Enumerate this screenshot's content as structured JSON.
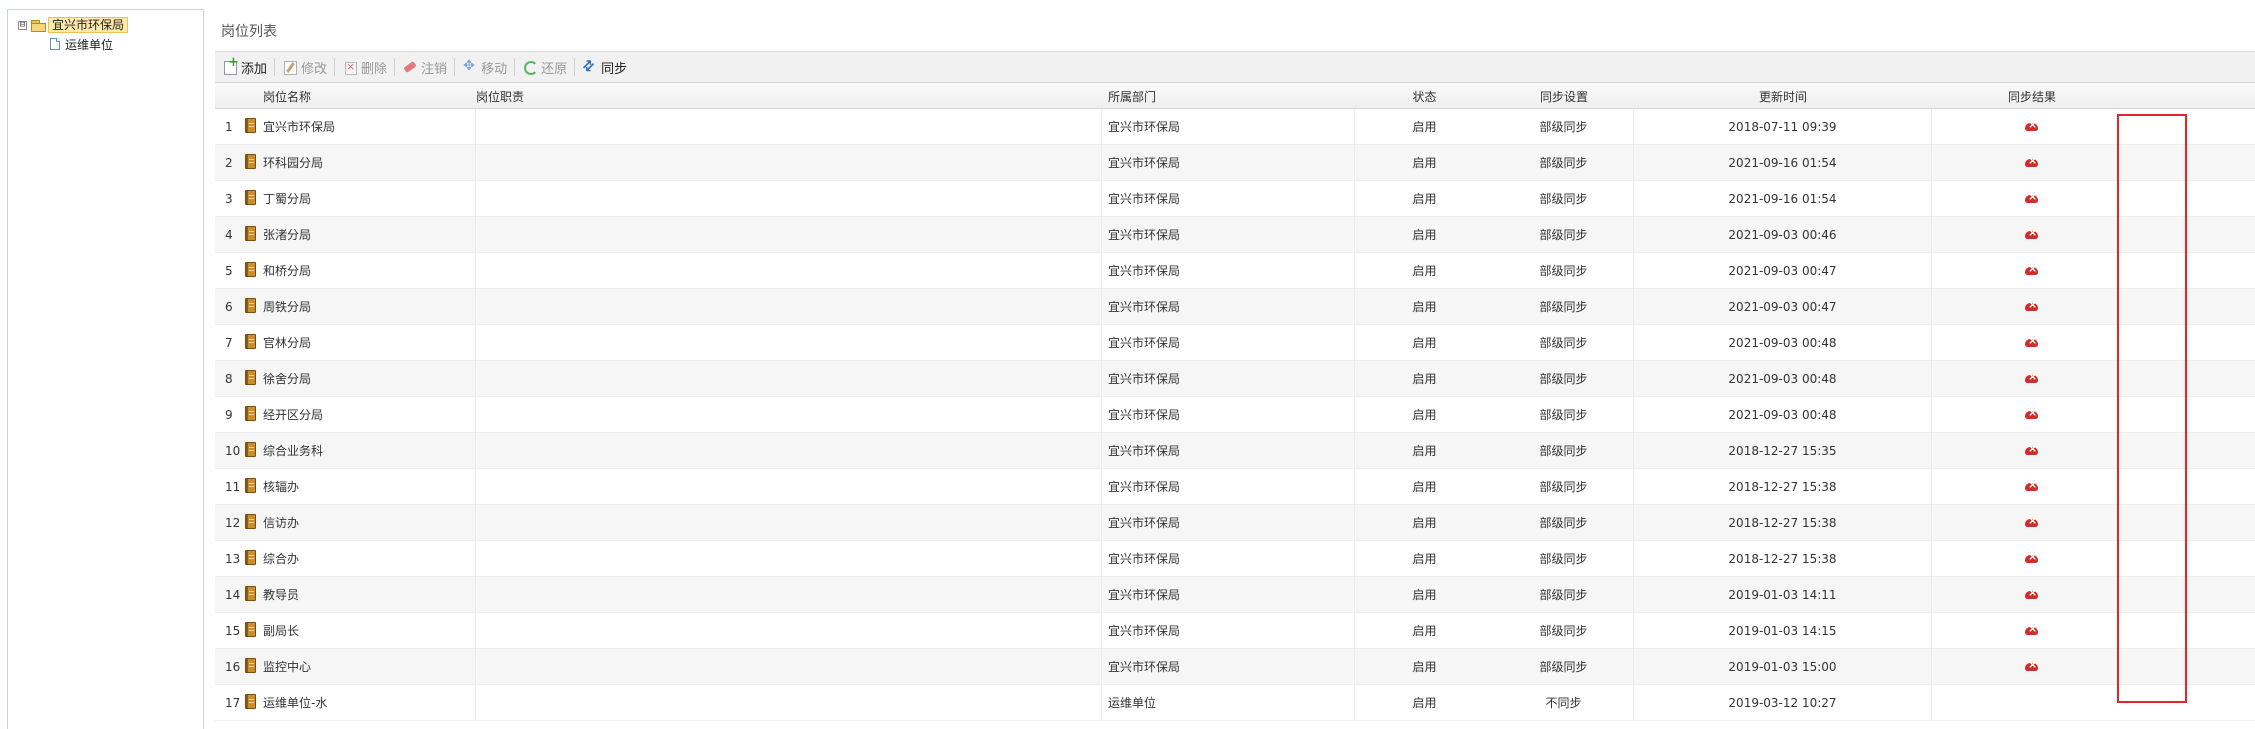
{
  "tree": {
    "root_label": "宜兴市环保局",
    "expander_symbol": "⊟",
    "children": [
      {
        "label": "运维单位"
      }
    ]
  },
  "panel_title": "岗位列表",
  "toolbar": {
    "add": "添加",
    "edit": "修改",
    "delete": "删除",
    "logout": "注销",
    "move": "移动",
    "restore": "还原",
    "sync": "同步"
  },
  "columns": {
    "name": "岗位名称",
    "duty": "岗位职责",
    "dept": "所属部门",
    "state": "状态",
    "sync_setting": "同步设置",
    "updated": "更新时间",
    "sync_result": "同步结果"
  },
  "rows": [
    {
      "num": "1",
      "name": "宜兴市环保局",
      "duty": "",
      "dept": "宜兴市环保局",
      "state": "启用",
      "sync_setting": "部级同步",
      "updated": "2018-07-11 09:39"
    },
    {
      "num": "2",
      "name": "环科园分局",
      "duty": "",
      "dept": "宜兴市环保局",
      "state": "启用",
      "sync_setting": "部级同步",
      "updated": "2021-09-16 01:54"
    },
    {
      "num": "3",
      "name": "丁蜀分局",
      "duty": "",
      "dept": "宜兴市环保局",
      "state": "启用",
      "sync_setting": "部级同步",
      "updated": "2021-09-16 01:54"
    },
    {
      "num": "4",
      "name": "张渚分局",
      "duty": "",
      "dept": "宜兴市环保局",
      "state": "启用",
      "sync_setting": "部级同步",
      "updated": "2021-09-03 00:46"
    },
    {
      "num": "5",
      "name": "和桥分局",
      "duty": "",
      "dept": "宜兴市环保局",
      "state": "启用",
      "sync_setting": "部级同步",
      "updated": "2021-09-03 00:47"
    },
    {
      "num": "6",
      "name": "周铁分局",
      "duty": "",
      "dept": "宜兴市环保局",
      "state": "启用",
      "sync_setting": "部级同步",
      "updated": "2021-09-03 00:47"
    },
    {
      "num": "7",
      "name": "官林分局",
      "duty": "",
      "dept": "宜兴市环保局",
      "state": "启用",
      "sync_setting": "部级同步",
      "updated": "2021-09-03 00:48"
    },
    {
      "num": "8",
      "name": "徐舍分局",
      "duty": "",
      "dept": "宜兴市环保局",
      "state": "启用",
      "sync_setting": "部级同步",
      "updated": "2021-09-03 00:48"
    },
    {
      "num": "9",
      "name": "经开区分局",
      "duty": "",
      "dept": "宜兴市环保局",
      "state": "启用",
      "sync_setting": "部级同步",
      "updated": "2021-09-03 00:48"
    },
    {
      "num": "10",
      "name": "综合业务科",
      "duty": "",
      "dept": "宜兴市环保局",
      "state": "启用",
      "sync_setting": "部级同步",
      "updated": "2018-12-27 15:35"
    },
    {
      "num": "11",
      "name": "核辐办",
      "duty": "",
      "dept": "宜兴市环保局",
      "state": "启用",
      "sync_setting": "部级同步",
      "updated": "2018-12-27 15:38"
    },
    {
      "num": "12",
      "name": "信访办",
      "duty": "",
      "dept": "宜兴市环保局",
      "state": "启用",
      "sync_setting": "部级同步",
      "updated": "2018-12-27 15:38"
    },
    {
      "num": "13",
      "name": "综合办",
      "duty": "",
      "dept": "宜兴市环保局",
      "state": "启用",
      "sync_setting": "部级同步",
      "updated": "2018-12-27 15:38"
    },
    {
      "num": "14",
      "name": "教导员",
      "duty": "",
      "dept": "宜兴市环保局",
      "state": "启用",
      "sync_setting": "部级同步",
      "updated": "2019-01-03 14:11"
    },
    {
      "num": "15",
      "name": "副局长",
      "duty": "",
      "dept": "宜兴市环保局",
      "state": "启用",
      "sync_setting": "部级同步",
      "updated": "2019-01-03 14:15"
    },
    {
      "num": "16",
      "name": "监控中心",
      "duty": "",
      "dept": "宜兴市环保局",
      "state": "启用",
      "sync_setting": "部级同步",
      "updated": "2019-01-03 15:00"
    },
    {
      "num": "17",
      "name": "运维单位-水",
      "duty": "",
      "dept": "运维单位",
      "state": "启用",
      "sync_setting": "不同步",
      "updated": "2019-03-12 10:27"
    }
  ],
  "sync_result_icon_rows": 16,
  "icons": {
    "row": "book-icon",
    "sync_result": "sync-failed-icon"
  },
  "colors": {
    "highlight_border": "#e0252c",
    "sync_result_icon": "#d42c2c",
    "tree_selected_bg": "#fde9a8"
  }
}
